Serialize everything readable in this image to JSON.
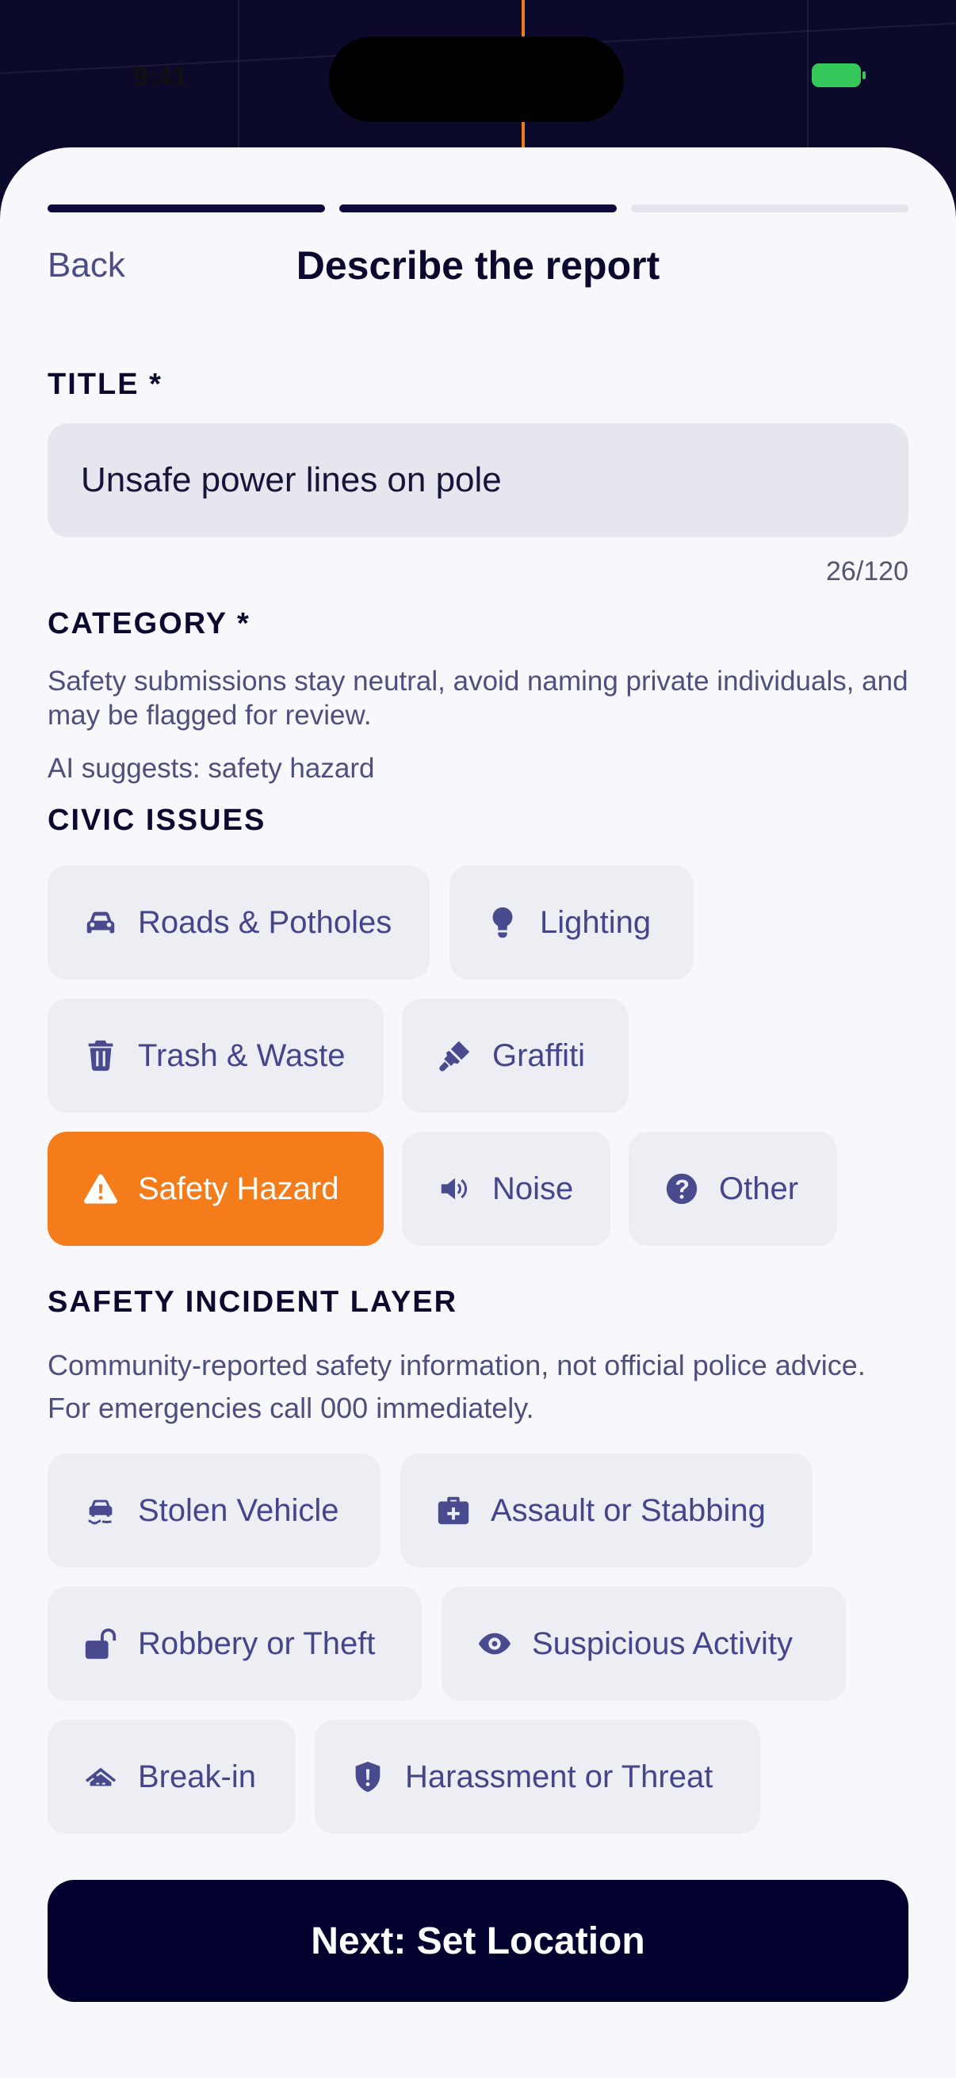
{
  "status_bar": {
    "time": "9:41"
  },
  "header": {
    "back_label": "Back",
    "title": "Describe the report",
    "progress": {
      "steps_total": 3,
      "steps_completed": 2
    }
  },
  "title_field": {
    "label": "TITLE *",
    "value": "Unsafe power lines on pole",
    "counter": "26/120"
  },
  "category": {
    "label": "CATEGORY *",
    "notice": "Safety submissions stay neutral, avoid naming private individuals, and may be flagged for review.",
    "ai_suggestion": "AI suggests: safety hazard",
    "selected": "Safety Hazard"
  },
  "civic_issues": {
    "heading": "CIVIC ISSUES",
    "items": [
      {
        "label": "Roads & Potholes",
        "icon": "car-icon"
      },
      {
        "label": "Lighting",
        "icon": "lightbulb-icon"
      },
      {
        "label": "Trash & Waste",
        "icon": "trash-icon"
      },
      {
        "label": "Graffiti",
        "icon": "paint-brush-icon"
      },
      {
        "label": "Safety Hazard",
        "icon": "warning-icon"
      },
      {
        "label": "Noise",
        "icon": "speaker-icon"
      },
      {
        "label": "Other",
        "icon": "question-icon"
      }
    ]
  },
  "safety_layer": {
    "heading": "SAFETY INCIDENT LAYER",
    "notice": "Community-reported safety information, not official police advice. For emergencies call 000 immediately.",
    "items": [
      {
        "label": "Stolen Vehicle",
        "icon": "car-skid-icon"
      },
      {
        "label": "Assault or Stabbing",
        "icon": "medical-kit-icon"
      },
      {
        "label": "Robbery or Theft",
        "icon": "unlock-icon"
      },
      {
        "label": "Suspicious Activity",
        "icon": "eye-icon"
      },
      {
        "label": "Break-in",
        "icon": "house-break-icon"
      },
      {
        "label": "Harassment or Threat",
        "icon": "shield-alert-icon"
      }
    ]
  },
  "footer": {
    "next_label": "Next: Set Location"
  },
  "colors": {
    "accent": "#F57C1A",
    "primary": "#03022E",
    "chip_bg": "#EDEDF4",
    "text_muted": "#4E4F7D"
  }
}
